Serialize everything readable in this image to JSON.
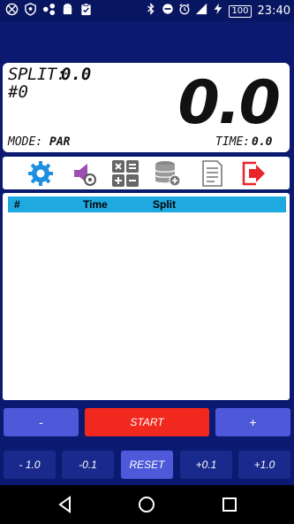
{
  "status_bar": {
    "time": "23:40",
    "battery": "100",
    "left_icons": [
      "no-sim-icon",
      "shield-icon",
      "share-icon",
      "android-icon",
      "clipboard-check-icon"
    ],
    "right_icons": [
      "bluetooth-icon",
      "dnd-icon",
      "alarm-icon",
      "signal-icon",
      "charging-icon"
    ]
  },
  "display": {
    "split_label": "SPLIT:",
    "split_value": "0.0",
    "lap_label": "#0",
    "main_time": "0.0",
    "mode_label": "MODE:",
    "mode_value": "PAR",
    "time_label": "TIME:",
    "time_value": "0.0"
  },
  "toolbar": {
    "icons": [
      "settings-gear-icon",
      "sound-settings-icon",
      "calculator-icon",
      "database-add-icon",
      "notes-icon",
      "exit-icon"
    ]
  },
  "table": {
    "columns": [
      "#",
      "Time",
      "Split"
    ],
    "header_color": "#1fa9e1",
    "rows": []
  },
  "controls": {
    "minus": "-",
    "start": "START",
    "plus": "+",
    "adjust": [
      "- 1.0",
      "-0.1",
      "RESET",
      "+0.1",
      "+1.0"
    ]
  },
  "colors": {
    "background": "#0b1a70",
    "button_blue": "#4d59d8",
    "start_red": "#f0281e",
    "adjust_dark": "#1a2a8c"
  }
}
